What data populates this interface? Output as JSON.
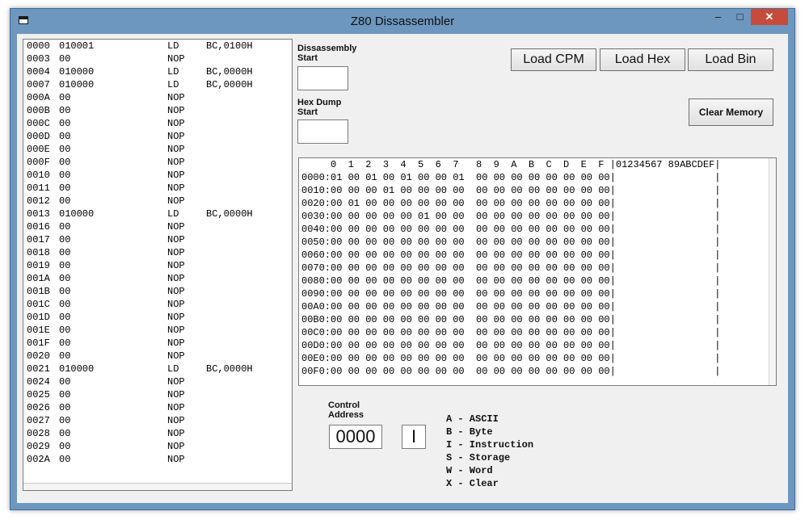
{
  "window": {
    "title": "Z80 Dissassembler",
    "minimize": "–",
    "maximize": "□",
    "close": "✕"
  },
  "disassembly": [
    {
      "addr": "0000",
      "bytes": "010001",
      "mn": "LD",
      "op": "BC,0100H"
    },
    {
      "addr": "0003",
      "bytes": "00",
      "mn": "NOP",
      "op": ""
    },
    {
      "addr": "0004",
      "bytes": "010000",
      "mn": "LD",
      "op": "BC,0000H"
    },
    {
      "addr": "0007",
      "bytes": "010000",
      "mn": "LD",
      "op": "BC,0000H"
    },
    {
      "addr": "000A",
      "bytes": "00",
      "mn": "NOP",
      "op": ""
    },
    {
      "addr": "000B",
      "bytes": "00",
      "mn": "NOP",
      "op": ""
    },
    {
      "addr": "000C",
      "bytes": "00",
      "mn": "NOP",
      "op": ""
    },
    {
      "addr": "000D",
      "bytes": "00",
      "mn": "NOP",
      "op": ""
    },
    {
      "addr": "000E",
      "bytes": "00",
      "mn": "NOP",
      "op": ""
    },
    {
      "addr": "000F",
      "bytes": "00",
      "mn": "NOP",
      "op": ""
    },
    {
      "addr": "0010",
      "bytes": "00",
      "mn": "NOP",
      "op": ""
    },
    {
      "addr": "0011",
      "bytes": "00",
      "mn": "NOP",
      "op": ""
    },
    {
      "addr": "0012",
      "bytes": "00",
      "mn": "NOP",
      "op": ""
    },
    {
      "addr": "0013",
      "bytes": "010000",
      "mn": "LD",
      "op": "BC,0000H"
    },
    {
      "addr": "0016",
      "bytes": "00",
      "mn": "NOP",
      "op": ""
    },
    {
      "addr": "0017",
      "bytes": "00",
      "mn": "NOP",
      "op": ""
    },
    {
      "addr": "0018",
      "bytes": "00",
      "mn": "NOP",
      "op": ""
    },
    {
      "addr": "0019",
      "bytes": "00",
      "mn": "NOP",
      "op": ""
    },
    {
      "addr": "001A",
      "bytes": "00",
      "mn": "NOP",
      "op": ""
    },
    {
      "addr": "001B",
      "bytes": "00",
      "mn": "NOP",
      "op": ""
    },
    {
      "addr": "001C",
      "bytes": "00",
      "mn": "NOP",
      "op": ""
    },
    {
      "addr": "001D",
      "bytes": "00",
      "mn": "NOP",
      "op": ""
    },
    {
      "addr": "001E",
      "bytes": "00",
      "mn": "NOP",
      "op": ""
    },
    {
      "addr": "001F",
      "bytes": "00",
      "mn": "NOP",
      "op": ""
    },
    {
      "addr": "0020",
      "bytes": "00",
      "mn": "NOP",
      "op": ""
    },
    {
      "addr": "0021",
      "bytes": "010000",
      "mn": "LD",
      "op": "BC,0000H"
    },
    {
      "addr": "0024",
      "bytes": "00",
      "mn": "NOP",
      "op": ""
    },
    {
      "addr": "0025",
      "bytes": "00",
      "mn": "NOP",
      "op": ""
    },
    {
      "addr": "0026",
      "bytes": "00",
      "mn": "NOP",
      "op": ""
    },
    {
      "addr": "0027",
      "bytes": "00",
      "mn": "NOP",
      "op": ""
    },
    {
      "addr": "0028",
      "bytes": "00",
      "mn": "NOP",
      "op": ""
    },
    {
      "addr": "0029",
      "bytes": "00",
      "mn": "NOP",
      "op": ""
    },
    {
      "addr": "002A",
      "bytes": "00",
      "mn": "NOP",
      "op": ""
    }
  ],
  "labels": {
    "disasm_start_1": "Dissassembly",
    "disasm_start_2": "Start",
    "hexdump_start_1": "Hex Dump",
    "hexdump_start_2": "Start",
    "control_1": "Control",
    "control_2": "Address"
  },
  "inputs": {
    "disasm_start": "",
    "hexdump_start": "",
    "control_address": "0000",
    "control_mode": "I"
  },
  "buttons": {
    "load_cpm": "Load CPM",
    "load_hex": "Load Hex",
    "load_bin": "Load Bin",
    "clear_memory": "Clear Memory"
  },
  "hexdump": {
    "header": "     0  1  2  3  4  5  6  7   8  9  A  B  C  D  E  F |01234567 89ABCDEF|",
    "rows": [
      {
        "addr": "0000",
        "bytes": [
          "01",
          "00",
          "01",
          "00",
          "01",
          "00",
          "00",
          "01",
          "00",
          "00",
          "00",
          "00",
          "00",
          "00",
          "00",
          "00"
        ]
      },
      {
        "addr": "0010",
        "bytes": [
          "00",
          "00",
          "00",
          "01",
          "00",
          "00",
          "00",
          "00",
          "00",
          "00",
          "00",
          "00",
          "00",
          "00",
          "00",
          "00"
        ]
      },
      {
        "addr": "0020",
        "bytes": [
          "00",
          "01",
          "00",
          "00",
          "00",
          "00",
          "00",
          "00",
          "00",
          "00",
          "00",
          "00",
          "00",
          "00",
          "00",
          "00"
        ]
      },
      {
        "addr": "0030",
        "bytes": [
          "00",
          "00",
          "00",
          "00",
          "00",
          "01",
          "00",
          "00",
          "00",
          "00",
          "00",
          "00",
          "00",
          "00",
          "00",
          "00"
        ]
      },
      {
        "addr": "0040",
        "bytes": [
          "00",
          "00",
          "00",
          "00",
          "00",
          "00",
          "00",
          "00",
          "00",
          "00",
          "00",
          "00",
          "00",
          "00",
          "00",
          "00"
        ]
      },
      {
        "addr": "0050",
        "bytes": [
          "00",
          "00",
          "00",
          "00",
          "00",
          "00",
          "00",
          "00",
          "00",
          "00",
          "00",
          "00",
          "00",
          "00",
          "00",
          "00"
        ]
      },
      {
        "addr": "0060",
        "bytes": [
          "00",
          "00",
          "00",
          "00",
          "00",
          "00",
          "00",
          "00",
          "00",
          "00",
          "00",
          "00",
          "00",
          "00",
          "00",
          "00"
        ]
      },
      {
        "addr": "0070",
        "bytes": [
          "00",
          "00",
          "00",
          "00",
          "00",
          "00",
          "00",
          "00",
          "00",
          "00",
          "00",
          "00",
          "00",
          "00",
          "00",
          "00"
        ]
      },
      {
        "addr": "0080",
        "bytes": [
          "00",
          "00",
          "00",
          "00",
          "00",
          "00",
          "00",
          "00",
          "00",
          "00",
          "00",
          "00",
          "00",
          "00",
          "00",
          "00"
        ]
      },
      {
        "addr": "0090",
        "bytes": [
          "00",
          "00",
          "00",
          "00",
          "00",
          "00",
          "00",
          "00",
          "00",
          "00",
          "00",
          "00",
          "00",
          "00",
          "00",
          "00"
        ]
      },
      {
        "addr": "00A0",
        "bytes": [
          "00",
          "00",
          "00",
          "00",
          "00",
          "00",
          "00",
          "00",
          "00",
          "00",
          "00",
          "00",
          "00",
          "00",
          "00",
          "00"
        ]
      },
      {
        "addr": "00B0",
        "bytes": [
          "00",
          "00",
          "00",
          "00",
          "00",
          "00",
          "00",
          "00",
          "00",
          "00",
          "00",
          "00",
          "00",
          "00",
          "00",
          "00"
        ]
      },
      {
        "addr": "00C0",
        "bytes": [
          "00",
          "00",
          "00",
          "00",
          "00",
          "00",
          "00",
          "00",
          "00",
          "00",
          "00",
          "00",
          "00",
          "00",
          "00",
          "00"
        ]
      },
      {
        "addr": "00D0",
        "bytes": [
          "00",
          "00",
          "00",
          "00",
          "00",
          "00",
          "00",
          "00",
          "00",
          "00",
          "00",
          "00",
          "00",
          "00",
          "00",
          "00"
        ]
      },
      {
        "addr": "00E0",
        "bytes": [
          "00",
          "00",
          "00",
          "00",
          "00",
          "00",
          "00",
          "00",
          "00",
          "00",
          "00",
          "00",
          "00",
          "00",
          "00",
          "00"
        ]
      },
      {
        "addr": "00F0",
        "bytes": [
          "00",
          "00",
          "00",
          "00",
          "00",
          "00",
          "00",
          "00",
          "00",
          "00",
          "00",
          "00",
          "00",
          "00",
          "00",
          "00"
        ]
      }
    ]
  },
  "legend": [
    "A - ASCII",
    "B - Byte",
    "I - Instruction",
    "S - Storage",
    "W - Word",
    "X - Clear"
  ],
  "colors": {
    "window_frame": "#6d97bf",
    "close_button": "#c74b3b",
    "client": "#f0f0f0"
  }
}
